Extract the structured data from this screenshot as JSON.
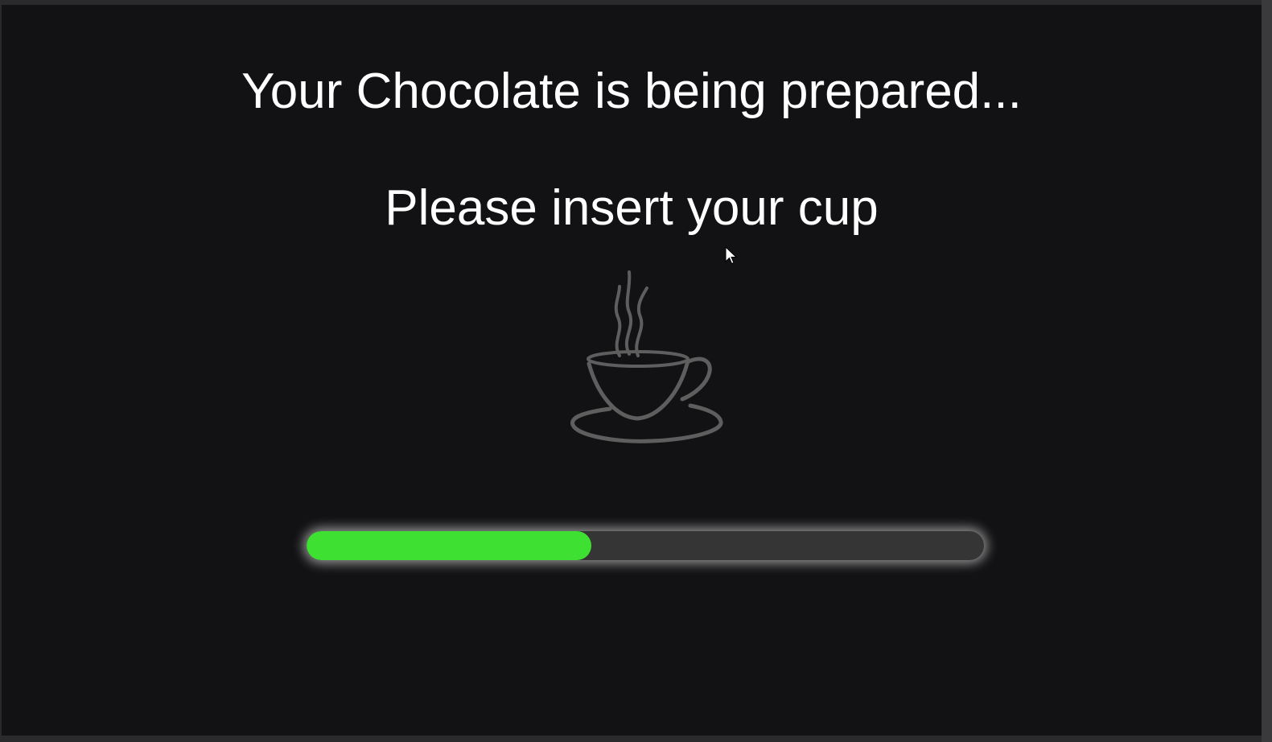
{
  "screen": {
    "heading": "Your Chocolate is being prepared...",
    "instruction": "Please insert your cup",
    "icon": "coffee-cup-steam-icon",
    "progress": {
      "fraction": 0.42,
      "fill_color": "#3ee132",
      "track_color": "#353535"
    },
    "background_color": "#121214",
    "text_color": "#ffffff"
  }
}
